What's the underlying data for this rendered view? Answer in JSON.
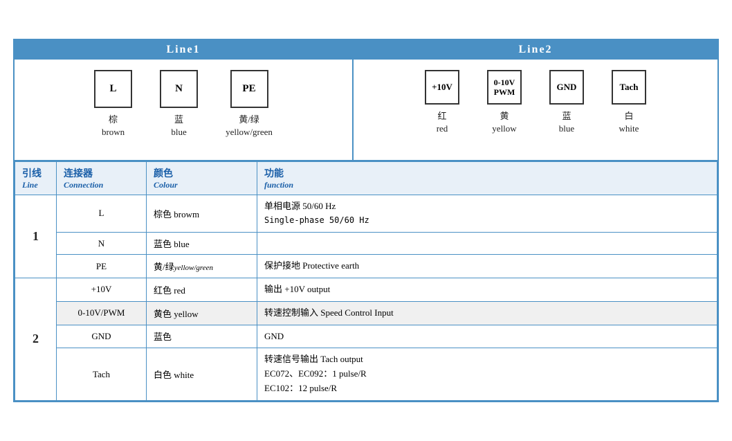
{
  "line1": {
    "header": "Line1",
    "connectors": [
      {
        "label": "L",
        "cn": "棕",
        "en": "brown"
      },
      {
        "label": "N",
        "cn": "蓝",
        "en": "blue"
      },
      {
        "label": "PE",
        "cn": "黄/绿",
        "en": "yellow/green"
      }
    ]
  },
  "line2": {
    "header": "Line2",
    "connectors": [
      {
        "label": "+10V",
        "cn": "红",
        "en": "red"
      },
      {
        "label1": "0-10V",
        "label2": "PWM",
        "cn": "黄",
        "en": "yellow"
      },
      {
        "label": "GND",
        "cn": "蓝",
        "en": "blue"
      },
      {
        "label": "Tach",
        "cn": "白",
        "en": "white"
      }
    ]
  },
  "table": {
    "headers": {
      "line": {
        "cn": "引线",
        "en": "Line"
      },
      "connection": {
        "cn": "连接器",
        "en": "Connection"
      },
      "colour": {
        "cn": "颜色",
        "en": "Colour"
      },
      "function": {
        "cn": "功能",
        "en": "function"
      }
    },
    "rows": [
      {
        "line": "1",
        "rowspan": 3,
        "entries": [
          {
            "connector": "L",
            "colour_cn": "棕色",
            "colour_en": "browm",
            "function": "单相电源 50/60 Hz\nSingle-phase 50/60 Hz"
          },
          {
            "connector": "N",
            "colour_cn": "蓝色",
            "colour_en": "blue",
            "function": ""
          },
          {
            "connector": "PE",
            "colour_cn": "黄/绿",
            "colour_en": "yellow/green",
            "function": "保护接地 Protective earth"
          }
        ]
      },
      {
        "line": "2",
        "rowspan": 4,
        "entries": [
          {
            "connector": "+10V",
            "colour_cn": "红色",
            "colour_en": "red",
            "function": "输出 +10V output"
          },
          {
            "connector": "0-10V/PWM",
            "colour_cn": "黄色",
            "colour_en": "yellow",
            "function": "转速控制输入 Speed Control Input"
          },
          {
            "connector": "GND",
            "colour_cn": "蓝色",
            "colour_en": "",
            "function": "GND",
            "gray": true
          },
          {
            "connector": "Tach",
            "colour_cn": "白色",
            "colour_en": "white",
            "function": "转速信号输出 Tach output\nEC072、EC092：1 pulse/R\nEC102：12 pulse/R"
          }
        ]
      }
    ]
  }
}
